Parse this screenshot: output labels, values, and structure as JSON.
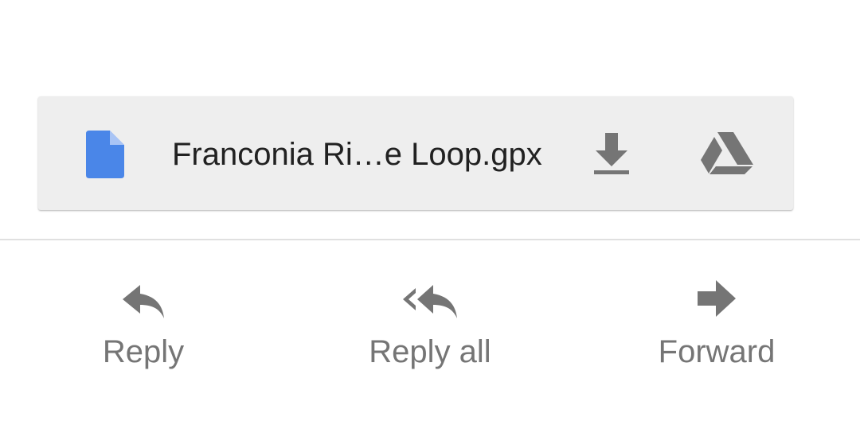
{
  "attachment": {
    "file_name": "Franconia Ri…e Loop.gpx",
    "file_icon": "document-icon",
    "download_icon": "download-icon",
    "drive_icon": "google-drive-icon"
  },
  "actions": [
    {
      "label": "Reply",
      "icon": "reply-icon"
    },
    {
      "label": "Reply all",
      "icon": "reply-all-icon"
    },
    {
      "label": "Forward",
      "icon": "forward-icon"
    }
  ],
  "colors": {
    "file_icon": "#4a86e8",
    "icon_gray": "#757575",
    "card_bg": "#eeeeee",
    "file_name_text": "#212121",
    "action_text": "#757575"
  }
}
